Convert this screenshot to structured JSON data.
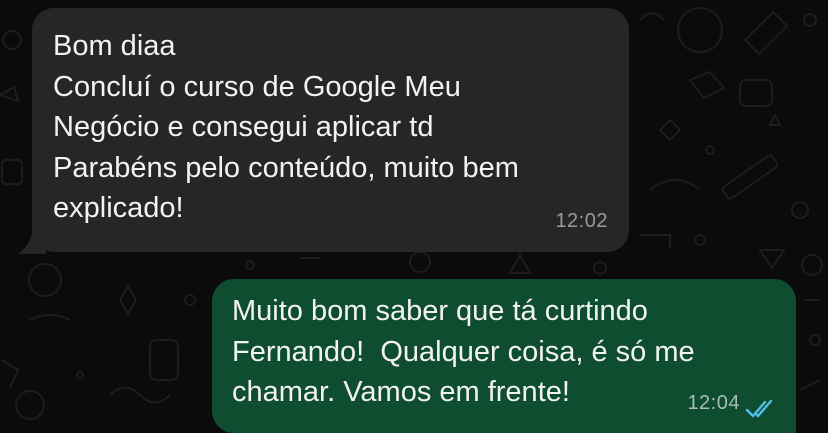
{
  "chat": {
    "messages": [
      {
        "direction": "incoming",
        "lines": [
          "Bom diaa",
          "Concluí o curso de Google Meu",
          "Negócio e consegui aplicar td",
          "Parabéns pelo conteúdo, muito bem",
          "explicado!"
        ],
        "time": "12:02"
      },
      {
        "direction": "outgoing",
        "lines": [
          "Muito bom saber que tá curtindo",
          "Fernando!  Qualquer coisa, é só me",
          "chamar. Vamos em frente!"
        ],
        "time": "12:04",
        "status_icon": "double-check-read-icon"
      }
    ]
  },
  "colors": {
    "background": "#0b0b0b",
    "incoming_bubble": "#262626",
    "outgoing_bubble": "#0e4d2f",
    "text": "#f2f2f2",
    "read_ticks": "#53bdeb"
  }
}
